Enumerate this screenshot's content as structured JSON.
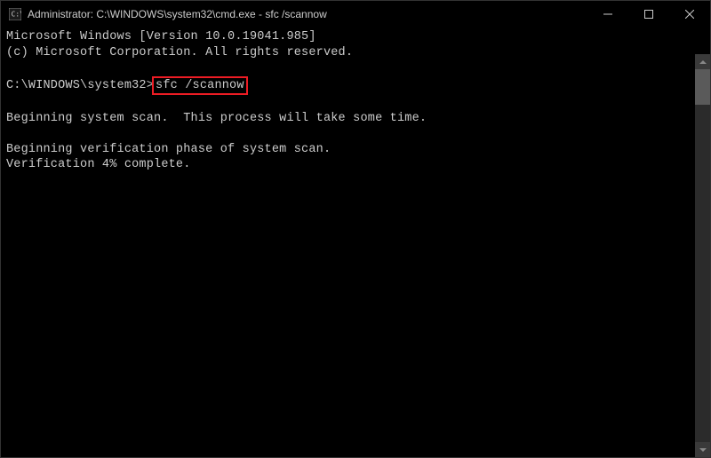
{
  "titlebar": {
    "title": "Administrator: C:\\WINDOWS\\system32\\cmd.exe - sfc  /scannow"
  },
  "terminal": {
    "line1": "Microsoft Windows [Version 10.0.19041.985]",
    "line2": "(c) Microsoft Corporation. All rights reserved.",
    "blank1": " ",
    "prompt": "C:\\WINDOWS\\system32>",
    "command": "sfc /scannow",
    "blank2": " ",
    "line3": "Beginning system scan.  This process will take some time.",
    "blank3": " ",
    "line4": "Beginning verification phase of system scan.",
    "line5": "Verification 4% complete."
  }
}
